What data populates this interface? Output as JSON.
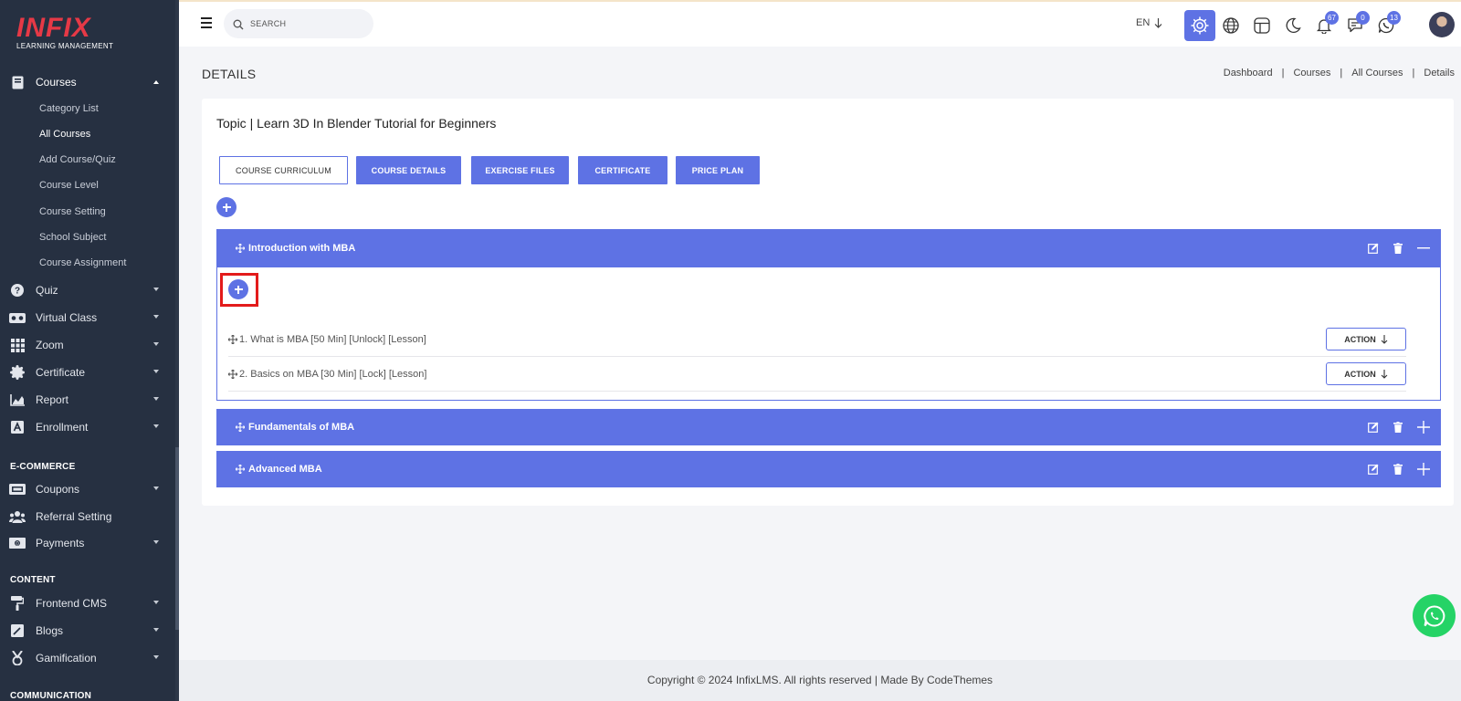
{
  "brand": {
    "logo_main": "INFIX",
    "logo_sub": "LEARNING MANAGEMENT"
  },
  "sidebar": {
    "courses": {
      "label": "Courses",
      "icon": "book-icon"
    },
    "course_sub": [
      {
        "label": "Category List",
        "active": false
      },
      {
        "label": "All Courses",
        "active": true
      },
      {
        "label": "Add Course/Quiz",
        "active": false
      },
      {
        "label": "Course Level",
        "active": false
      },
      {
        "label": "Course Setting",
        "active": false
      },
      {
        "label": "School Subject",
        "active": false
      },
      {
        "label": "Course Assignment",
        "active": false
      }
    ],
    "items": [
      {
        "label": "Quiz",
        "icon": "question-icon"
      },
      {
        "label": "Virtual Class",
        "icon": "vr-icon"
      },
      {
        "label": "Zoom",
        "icon": "grid-icon"
      },
      {
        "label": "Certificate",
        "icon": "badge-icon"
      },
      {
        "label": "Report",
        "icon": "chart-icon"
      },
      {
        "label": "Enrollment",
        "icon": "enroll-icon"
      }
    ],
    "ecommerce_label": "E-COMMERCE",
    "ecommerce": [
      {
        "label": "Coupons",
        "icon": "coupon-icon"
      },
      {
        "label": "Referral Setting",
        "icon": "users-icon"
      },
      {
        "label": "Payments",
        "icon": "money-icon"
      }
    ],
    "content_label": "CONTENT",
    "content": [
      {
        "label": "Frontend CMS",
        "icon": "paint-roller-icon"
      },
      {
        "label": "Blogs",
        "icon": "pen-icon"
      },
      {
        "label": "Gamification",
        "icon": "medal-icon"
      }
    ],
    "communication_label": "COMMUNICATION"
  },
  "topbar": {
    "search_placeholder": "SEARCH",
    "language": "EN",
    "notifications_count": "67",
    "messages_count": "0",
    "whatsapp_count": "13"
  },
  "page": {
    "title": "DETAILS",
    "breadcrumb": [
      "Dashboard",
      "Courses",
      "All Courses",
      "Details"
    ]
  },
  "course": {
    "topic_title": "Topic | Learn 3D In Blender Tutorial for Beginners",
    "tabs": [
      "COURSE CURRICULUM",
      "COURSE DETAILS",
      "EXERCISE FILES",
      "CERTIFICATE",
      "PRICE PLAN"
    ],
    "sections": [
      {
        "title": "Introduction with MBA",
        "expanded": true,
        "lessons": [
          {
            "text": "1. What is MBA [50 Min] [Unlock] [Lesson]",
            "action": "ACTION"
          },
          {
            "text": "2. Basics on MBA [30 Min] [Lock] [Lesson]",
            "action": "ACTION"
          }
        ]
      },
      {
        "title": "Fundamentals of MBA",
        "expanded": false
      },
      {
        "title": "Advanced MBA",
        "expanded": false
      }
    ]
  },
  "footer": {
    "text": "Copyright © 2024 InfixLMS. All rights reserved | Made By CodeThemes"
  },
  "colors": {
    "primary": "#5e72e4",
    "sidebar": "#263041",
    "highlight": "#e31b1b",
    "whatsapp": "#25d366"
  }
}
